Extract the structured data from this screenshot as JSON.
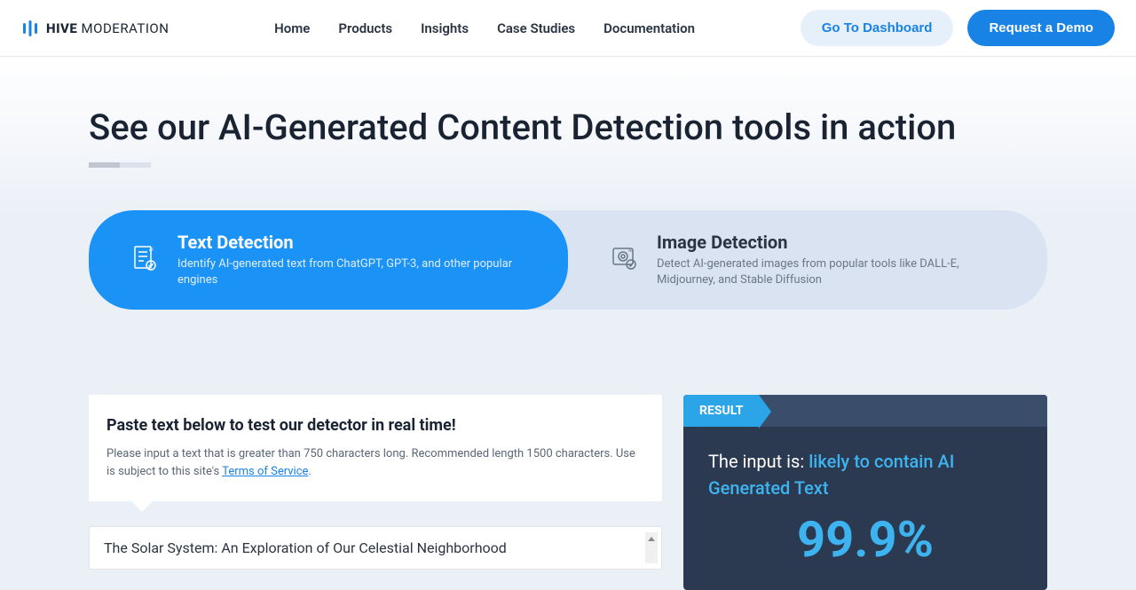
{
  "header": {
    "logo_bold": "HIVE",
    "logo_light": " MODERATION",
    "nav": {
      "home": "Home",
      "products": "Products",
      "insights": "Insights",
      "case_studies": "Case Studies",
      "documentation": "Documentation"
    },
    "dashboard_btn": "Go To Dashboard",
    "demo_btn": "Request a Demo"
  },
  "main": {
    "title": "See our AI-Generated Content Detection tools in action",
    "tabs": {
      "text": {
        "title": "Text Detection",
        "desc": "Identify AI-generated text from ChatGPT, GPT-3, and other popular engines"
      },
      "image": {
        "title": "Image Detection",
        "desc": "Detect AI-generated images from popular tools like DALL-E, Midjourney, and Stable Diffusion"
      }
    },
    "input": {
      "title": "Paste text below to test our detector in real time!",
      "desc_pre": "Please input a text that is greater than 750 characters long. Recommended length 1500 characters. Use is subject to this site's ",
      "tos_link": "Terms of Service",
      "desc_post": ".",
      "textarea_value": "The Solar System: An Exploration of Our Celestial Neighborhood"
    },
    "result": {
      "badge": "RESULT",
      "prefix": "The input is: ",
      "verdict": "likely to contain AI Generated Text",
      "percent": "99.9%"
    }
  }
}
